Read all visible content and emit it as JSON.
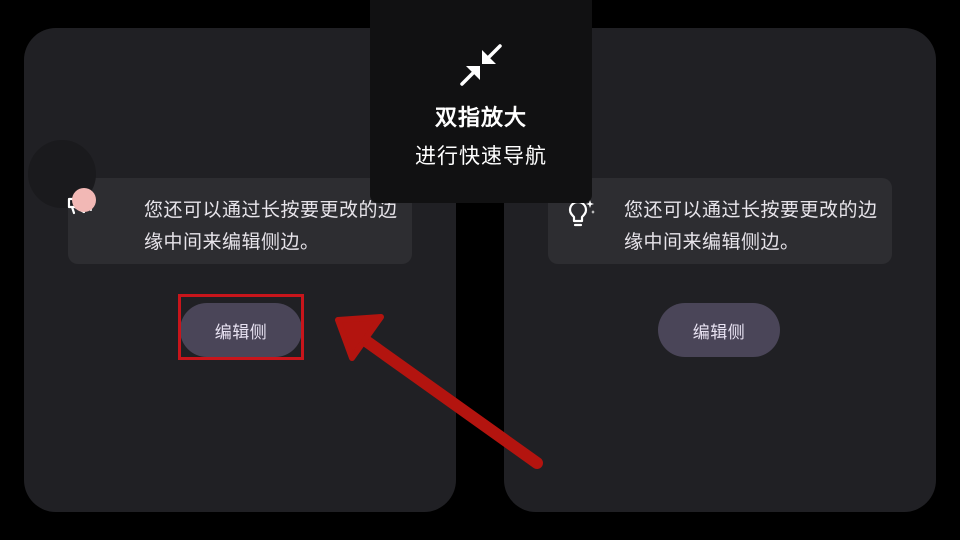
{
  "gesture_hint": {
    "title": "双指放大",
    "subtitle": "进行快速导航",
    "icon": "pinch-collapse-icon"
  },
  "left_panel": {
    "tip_text": "您还可以通过长按要更改的边缘中间来编辑侧边。",
    "tip_icon": "megaphone-icon",
    "button_label": "编辑侧"
  },
  "right_panel": {
    "tip_text": "您还可以通过长按要更改的边缘中间来编辑侧边。",
    "tip_icon": "lightbulb-sparkle-icon",
    "button_label": "编辑侧"
  },
  "colors": {
    "background": "#000000",
    "panel": "#202024",
    "tip_card": "#2d2d31",
    "button": "#4a4558",
    "highlight": "#c8151b",
    "notification_dot": "#f2b8b5"
  }
}
